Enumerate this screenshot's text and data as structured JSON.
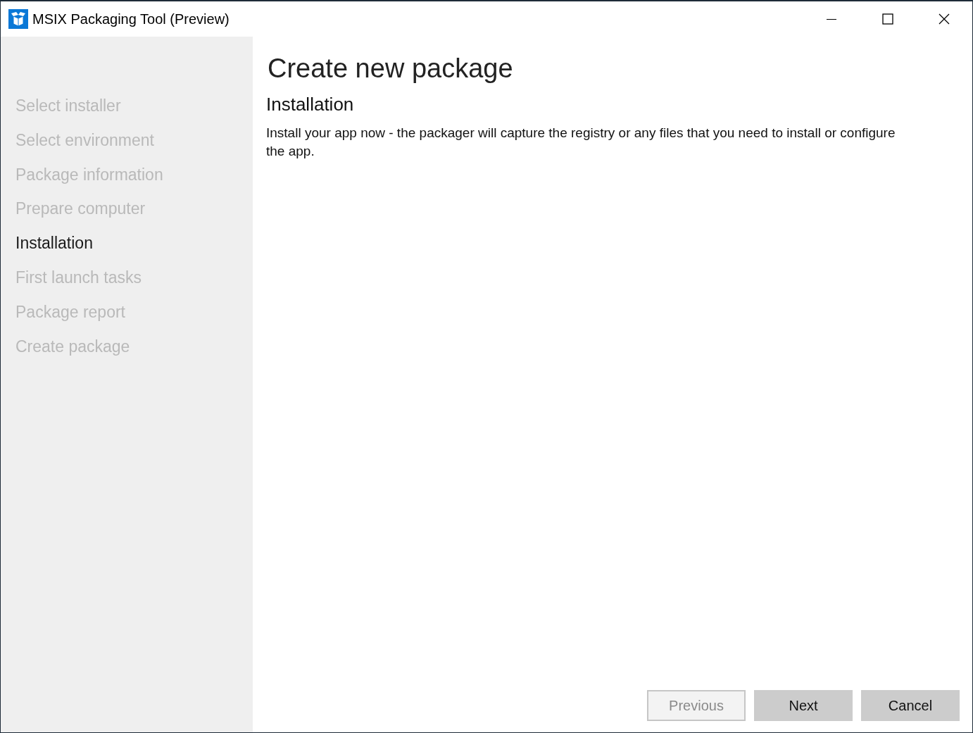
{
  "window": {
    "title": "MSIX Packaging Tool (Preview)"
  },
  "sidebar": {
    "steps": [
      {
        "label": "Select installer",
        "selected": false
      },
      {
        "label": "Select environment",
        "selected": false
      },
      {
        "label": "Package information",
        "selected": false
      },
      {
        "label": "Prepare computer",
        "selected": false
      },
      {
        "label": "Installation",
        "selected": true
      },
      {
        "label": "First launch tasks",
        "selected": false
      },
      {
        "label": "Package report",
        "selected": false
      },
      {
        "label": "Create package",
        "selected": false
      }
    ]
  },
  "content": {
    "title": "Create new package",
    "heading": "Installation",
    "description": "Install your app now - the packager will capture the registry or any files that you need to install or configure the app."
  },
  "buttons": [
    {
      "label": "Previous",
      "disabled": true
    },
    {
      "label": "Next",
      "disabled": false
    },
    {
      "label": "Cancel",
      "disabled": false
    }
  ]
}
